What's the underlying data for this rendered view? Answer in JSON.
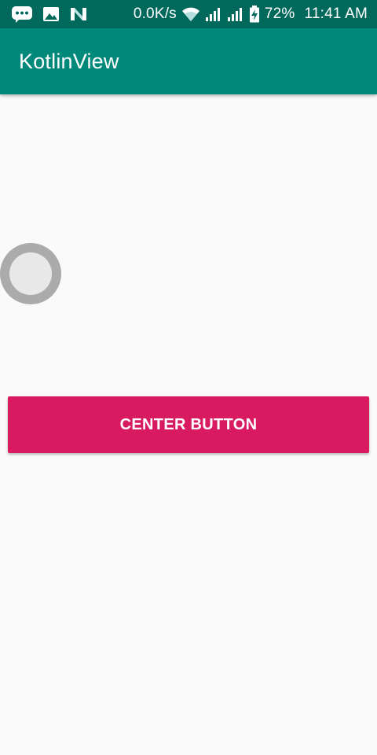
{
  "status_bar": {
    "net_speed": "0.0K/s",
    "battery_percent": "72%",
    "time": "11:41 AM",
    "icons": [
      "chat-bubble-icon",
      "image-icon",
      "n-logo-icon",
      "wifi-icon",
      "signal-icon",
      "signal-icon-2",
      "battery-charging-icon"
    ]
  },
  "app_bar": {
    "title": "KotlinView"
  },
  "main": {
    "center_button_label": "CENTER BUTTON"
  },
  "colors": {
    "status_bar": "#00695c",
    "app_bar": "#00897b",
    "accent_button": "#d81b60",
    "background": "#fafafa",
    "circle_outer": "#ababab",
    "circle_inner": "#e8e8e8"
  }
}
